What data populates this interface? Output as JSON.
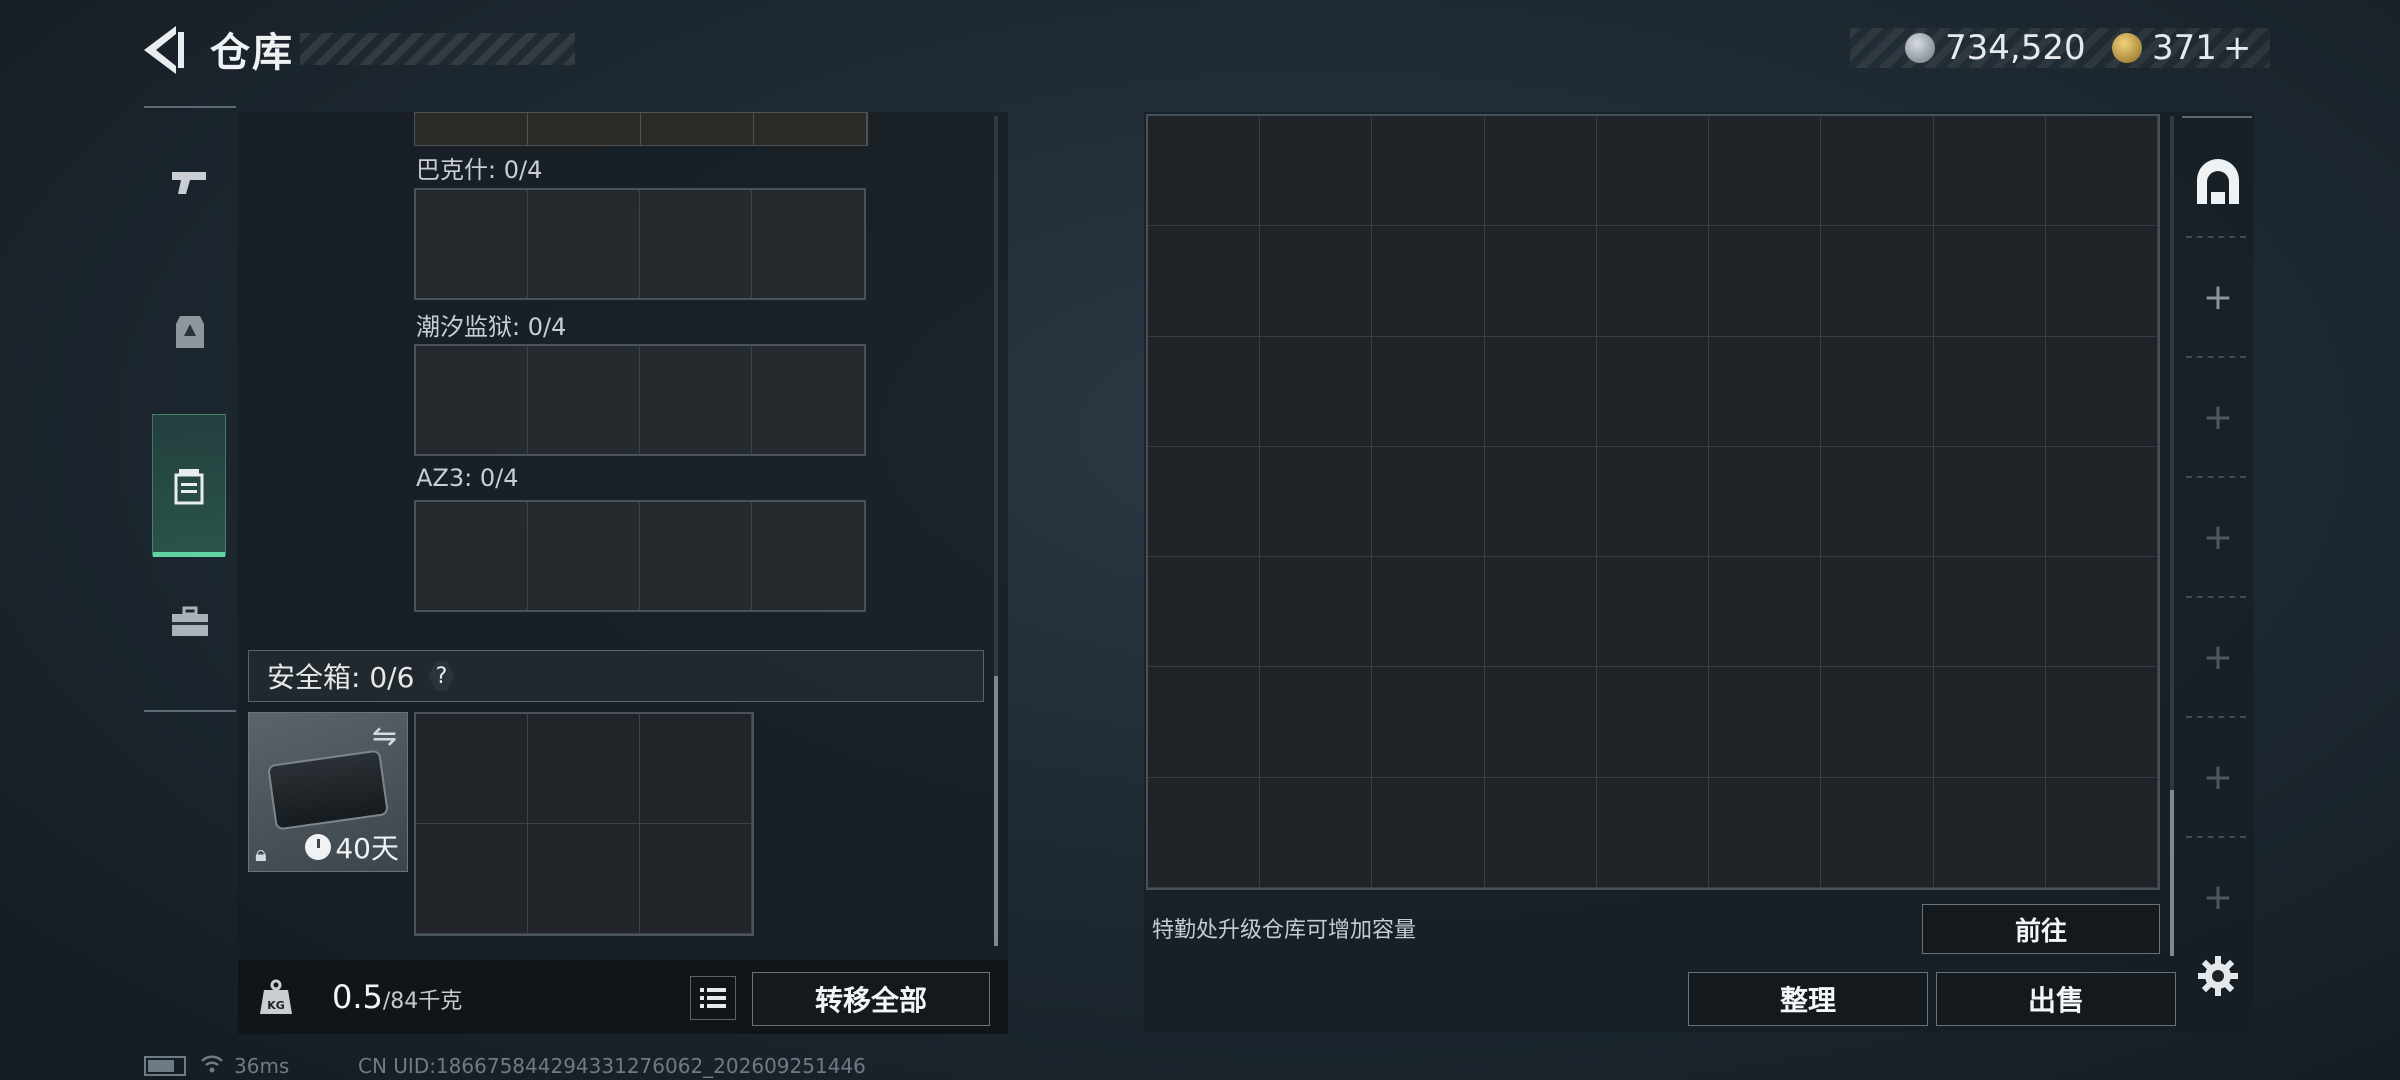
{
  "header": {
    "title": "仓库",
    "currency_silver": "734,520",
    "currency_gold": "371",
    "add_symbol": "+"
  },
  "loadout": {
    "sections": [
      {
        "label": "巴克什: 0/4"
      },
      {
        "label": "潮汐监狱: 0/4"
      },
      {
        "label": "AZ3: 0/4"
      }
    ],
    "safe_box": {
      "label": "安全箱: 0/6",
      "help": "?",
      "case_time": "40天"
    },
    "weight_value": "0.5",
    "weight_capacity": "/84千克",
    "transfer_all": "转移全部"
  },
  "storage": {
    "hint": "特勤处升级仓库可增加容量",
    "goto_label": "前往",
    "sort_label": "整理",
    "sell_label": "出售",
    "tabs_add": [
      "+",
      "+",
      "+",
      "+",
      "+",
      "+"
    ]
  },
  "status": {
    "ping": "36ms",
    "uid": "CN UID:18667584429433127​6062_202609251446"
  }
}
